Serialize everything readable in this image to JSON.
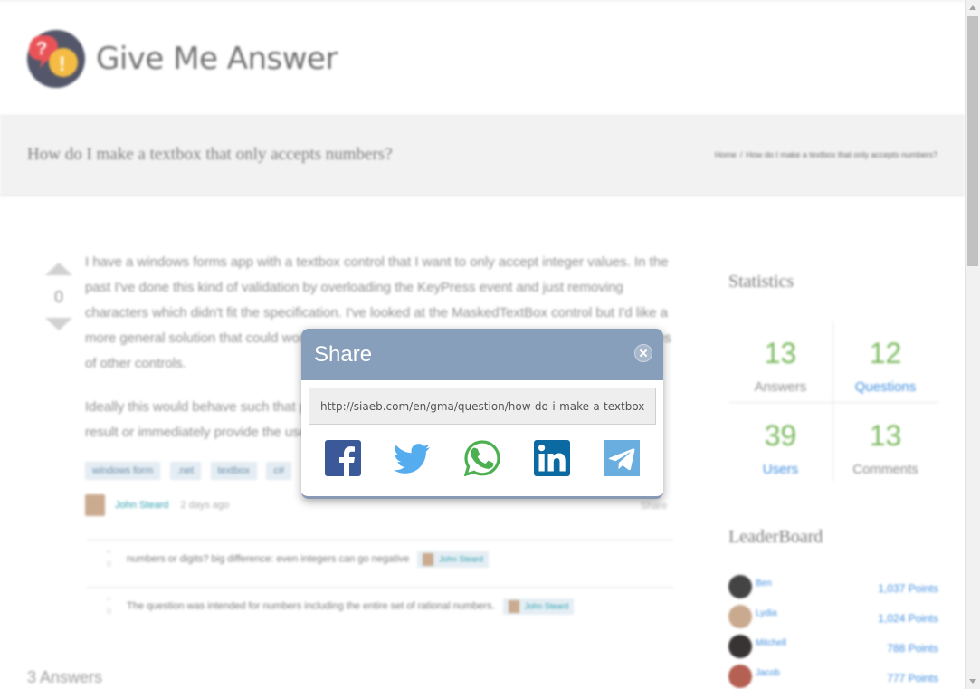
{
  "site": {
    "logo_text": "Give Me Answer"
  },
  "question": {
    "title": "How do I make a textbox that only accepts numbers?",
    "vote_count": "0",
    "body_p1": "I have a windows forms app with a textbox control that I want to only accept integer values. In the past I've done this kind of validation by overloading the KeyPress event and just removing characters which didn't fit the specification. I've looked at the MaskedTextBox control but I'd like a more general solution that could work with perhaps a regular expression, or depend on the values of other controls.",
    "body_p2": "Ideally this would behave such that pressing a non numeric character would either produce no result or immediately provide the user with feedback about the invalid character.",
    "tags": [
      "windows form",
      ".net",
      "textbox",
      "c#"
    ],
    "author": "John Steard",
    "time": "2 days ago",
    "share_label": "Share"
  },
  "breadcrumb": {
    "home": "Home",
    "separator": "/",
    "current": "How do I make a textbox that only accepts numbers?"
  },
  "comments": [
    {
      "votes": "0",
      "text": "numbers or digits? big difference: even integers can go negative",
      "author": "John Steard"
    },
    {
      "votes": "0",
      "text": "The question was intended for numbers including the entire set of rational numbers.",
      "author": "John Steard"
    }
  ],
  "answers_heading": "3 Answers",
  "statistics": {
    "title": "Statistics",
    "answers": {
      "value": "13",
      "label": "Answers"
    },
    "questions": {
      "value": "12",
      "label": "Questions"
    },
    "users": {
      "value": "39",
      "label": "Users"
    },
    "comments": {
      "value": "13",
      "label": "Comments"
    }
  },
  "leaderboard": {
    "title": "LeaderBoard",
    "entries": [
      {
        "name": "Ben",
        "points": "1,037 Points"
      },
      {
        "name": "Lydia",
        "points": "1,024 Points"
      },
      {
        "name": "Mitchell",
        "points": "788 Points"
      },
      {
        "name": "Jacob",
        "points": "777 Points"
      }
    ]
  },
  "share_dialog": {
    "title": "Share",
    "url": "http://siaeb.com/en/gma/question/how-do-i-make-a-textbox-that-only-accepts-numbers",
    "networks": [
      {
        "icon": "facebook-icon",
        "color": "#3b5998"
      },
      {
        "icon": "twitter-icon",
        "color": "#55acee"
      },
      {
        "icon": "whatsapp-icon",
        "color": "#4caf50"
      },
      {
        "icon": "linkedin-icon",
        "color": "#0b6aa2"
      },
      {
        "icon": "telegram-icon",
        "color": "#6aaee0"
      }
    ]
  }
}
